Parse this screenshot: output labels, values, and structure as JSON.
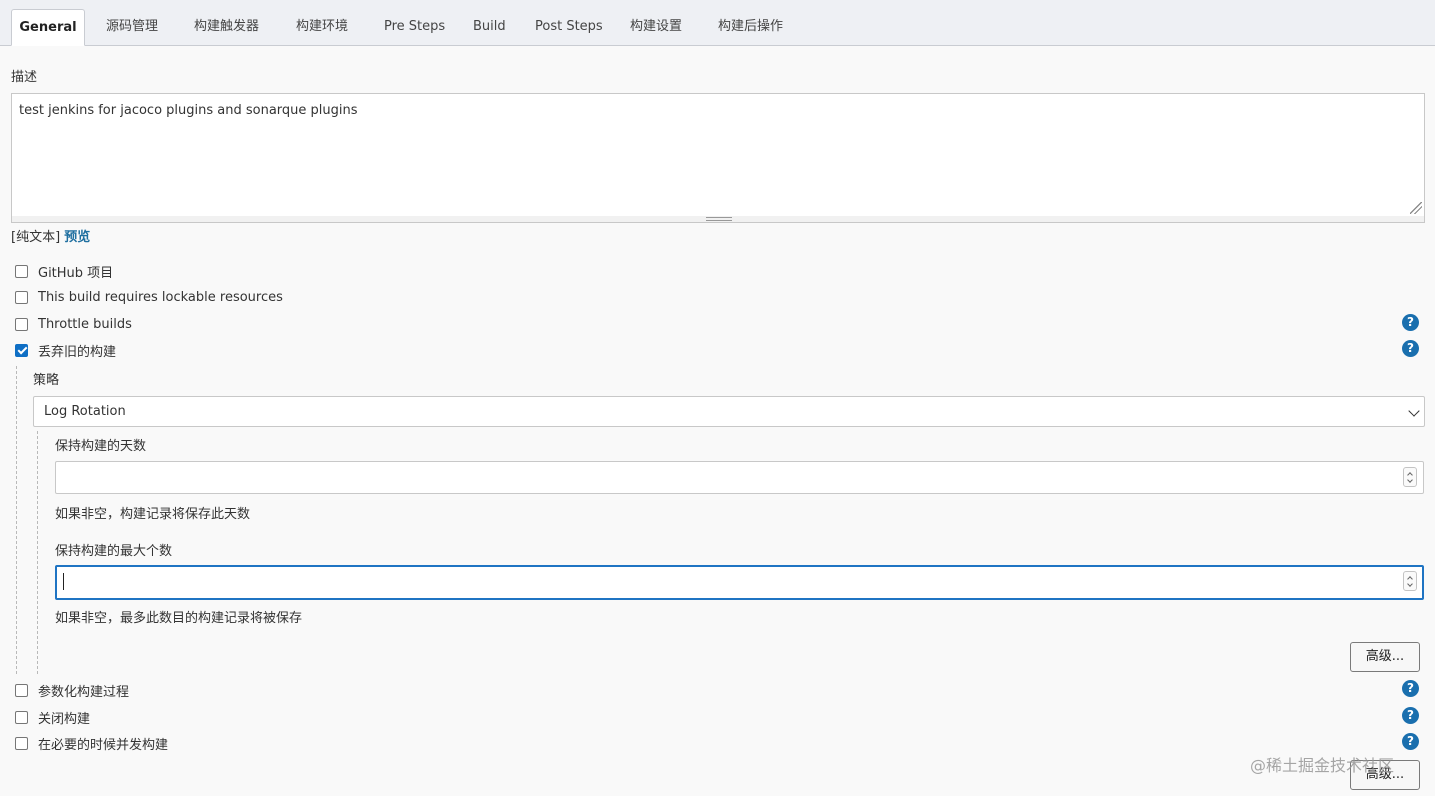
{
  "tabs": [
    {
      "label": "General",
      "active": true
    },
    {
      "label": "源码管理"
    },
    {
      "label": "构建触发器"
    },
    {
      "label": "构建环境"
    },
    {
      "label": "Pre Steps"
    },
    {
      "label": "Build"
    },
    {
      "label": "Post Steps"
    },
    {
      "label": "构建设置"
    },
    {
      "label": "构建后操作"
    }
  ],
  "description": {
    "label": "描述",
    "value": "test jenkins for jacoco plugins and sonarque plugins",
    "format_plain": "[纯文本]",
    "format_preview": "预览"
  },
  "options": [
    {
      "label": "GitHub 项目",
      "checked": false
    },
    {
      "label": "This build requires lockable resources",
      "checked": false
    },
    {
      "label": "Throttle builds",
      "checked": false
    },
    {
      "label": "丢弃旧的构建",
      "checked": true
    }
  ],
  "discard": {
    "strategy_label": "策略",
    "strategy_value": "Log Rotation",
    "days_label": "保持构建的天数",
    "days_value": "",
    "days_hint": "如果非空，构建记录将保存此天数",
    "max_label": "保持构建的最大个数",
    "max_value": "",
    "max_hint": "如果非空，最多此数目的构建记录将被保存",
    "advanced_label": "高级..."
  },
  "options_bottom": [
    {
      "label": "参数化构建过程",
      "checked": false
    },
    {
      "label": "关闭构建",
      "checked": false
    },
    {
      "label": "在必要的时候并发构建",
      "checked": false
    }
  ],
  "help_glyph": "?",
  "bottom_advanced_label": "高级...",
  "watermark": "@稀土掘金技术社区",
  "colors": {
    "accent": "#0f6fc5",
    "help": "#1a6fae",
    "link": "#1f6fa0"
  }
}
